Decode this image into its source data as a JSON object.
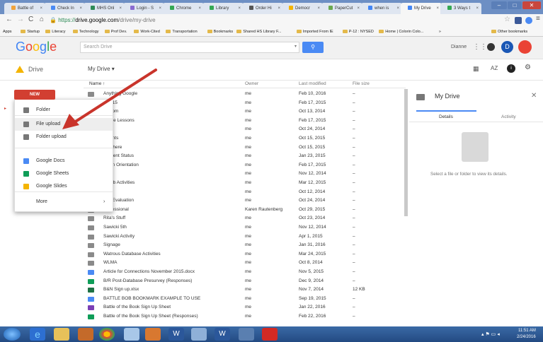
{
  "browser": {
    "tabs": [
      {
        "label": "Battle of",
        "color": "#f1a33b"
      },
      {
        "label": "Check In",
        "color": "#4a8af4"
      },
      {
        "label": "MHS Onl",
        "color": "#2e8b57"
      },
      {
        "label": "Login - S",
        "color": "#8a6bd1"
      },
      {
        "label": "Chrome",
        "color": "#34a853"
      },
      {
        "label": "Library",
        "color": "#34a853"
      },
      {
        "label": "Order Hi",
        "color": "#555555"
      },
      {
        "label": "Democr",
        "color": "#f4b400"
      },
      {
        "label": "PaperCut",
        "color": "#6aa84f"
      },
      {
        "label": "when is",
        "color": "#4285f4"
      },
      {
        "label": "My Drive",
        "color": "#4285f4"
      },
      {
        "label": "3 Ways t",
        "color": "#34a853"
      }
    ],
    "url_prefix": "https://",
    "url_host": "drive.google.com",
    "url_path": "/drive/my-drive",
    "bookmarks": [
      {
        "label": "Apps"
      },
      {
        "label": "Startup"
      },
      {
        "label": "Literacy"
      },
      {
        "label": "Technology"
      },
      {
        "label": "Prof Dev."
      },
      {
        "label": "Work-Cited"
      },
      {
        "label": "Transportation"
      },
      {
        "label": "Bookmarks"
      },
      {
        "label": "Shared HS Library F..."
      },
      {
        "label": "Imported From IE"
      },
      {
        "label": "P-12 : NYSED"
      },
      {
        "label": "Home | Colorin Colo..."
      },
      {
        "label": "»"
      },
      {
        "label": "Other bookmarks"
      }
    ]
  },
  "google": {
    "logo": "Google",
    "search_placeholder": "Search Drive",
    "user_name": "Dianne",
    "avatar_letter": "D"
  },
  "drive": {
    "title": "Drive",
    "breadcrumb": "My Drive",
    "new_label": "NEW",
    "menu": [
      {
        "label": "Folder",
        "icon": "folder-plus-icon",
        "color": "#777777"
      },
      {
        "label": "File upload",
        "icon": "file-upload-icon",
        "color": "#777777"
      },
      {
        "label": "Folder upload",
        "icon": "folder-upload-icon",
        "color": "#777777"
      },
      {
        "label": "Google Docs",
        "icon": "docs-icon",
        "color": "#4a8af4"
      },
      {
        "label": "Google Sheets",
        "icon": "sheets-icon",
        "color": "#0f9d58"
      },
      {
        "label": "Google Slides",
        "icon": "slides-icon",
        "color": "#f4b400"
      },
      {
        "label": "More",
        "icon": "",
        "color": ""
      }
    ],
    "columns": {
      "name": "Name",
      "owner": "Owner",
      "modified": "Last modified",
      "size": "File size"
    },
    "files": [
      {
        "name": "Anything Google",
        "owner": "me",
        "modified": "Feb 10, 2016",
        "size": "–",
        "type": "folder"
      },
      {
        "name": "e 2015",
        "owner": "me",
        "modified": "Feb 17, 2015",
        "size": "–",
        "type": "folder"
      },
      {
        "name": "ssroom",
        "owner": "me",
        "modified": "Oct 13, 2014",
        "size": "–",
        "type": "folder"
      },
      {
        "name": "abase Lessons",
        "owner": "me",
        "modified": "Feb 17, 2015",
        "size": "–",
        "type": "folder"
      },
      {
        "name": "ktop",
        "owner": "me",
        "modified": "Oct 24, 2014",
        "size": "–",
        "type": "folder"
      },
      {
        "name": "uments",
        "owner": "me",
        "modified": "Oct 15, 2015",
        "size": "–",
        "type": "folder"
      },
      {
        "name": "files here",
        "owner": "me",
        "modified": "Oct 15, 2015",
        "size": "–",
        "type": "folder"
      },
      {
        "name": "loyment Status",
        "owner": "me",
        "modified": "Jan 23, 2015",
        "size": "–",
        "type": "folder"
      },
      {
        "name": "hman Orientation",
        "owner": "me",
        "modified": "Feb 17, 2015",
        "size": "–",
        "type": "folder"
      },
      {
        "name": "Club",
        "owner": "me",
        "modified": "Nov 12, 2014",
        "size": "–",
        "type": "folder"
      },
      {
        "name": "r Web Activities",
        "owner": "me",
        "modified": "Mar 12, 2015",
        "size": "–",
        "type": "folder"
      },
      {
        "name": "P     ★",
        "owner": "me",
        "modified": "Oct 12, 2014",
        "size": "–",
        "type": "folder"
      },
      {
        "name": "and Evaluation",
        "owner": "me",
        "modified": "Oct 24, 2014",
        "size": "–",
        "type": "folder"
      },
      {
        "name": "Professional",
        "owner": "Karen Rautenberg",
        "modified": "Oct 29, 2015",
        "size": "–",
        "type": "folder"
      },
      {
        "name": "Rita's Stuff",
        "owner": "me",
        "modified": "Oct 23, 2014",
        "size": "–",
        "type": "folder"
      },
      {
        "name": "Sawicki 5th",
        "owner": "me",
        "modified": "Nov 12, 2014",
        "size": "–",
        "type": "folder"
      },
      {
        "name": "Sawicki Activity",
        "owner": "me",
        "modified": "Apr 1, 2015",
        "size": "–",
        "type": "folder"
      },
      {
        "name": "Signage",
        "owner": "me",
        "modified": "Jan 31, 2016",
        "size": "–",
        "type": "folder"
      },
      {
        "name": "Watrous Database Activities",
        "owner": "me",
        "modified": "Mar 24, 2015",
        "size": "–",
        "type": "folder"
      },
      {
        "name": "WLMA",
        "owner": "me",
        "modified": "Oct 8, 2014",
        "size": "–",
        "type": "folder"
      },
      {
        "name": "Article for Connections November 2015.docx",
        "owner": "me",
        "modified": "Nov 5, 2015",
        "size": "–",
        "type": "doc"
      },
      {
        "name": "B/R Post-Database Presurvey (Responses)",
        "owner": "me",
        "modified": "Dec 9, 2014",
        "size": "–",
        "type": "sheet"
      },
      {
        "name": "B&N Sign up.xlsx",
        "owner": "me",
        "modified": "Nov 7, 2014",
        "size": "12 KB",
        "type": "excel"
      },
      {
        "name": "BATTLE BOB BOOKMARK EXAMPLE TO USE",
        "owner": "me",
        "modified": "Sep 19, 2015",
        "size": "–",
        "type": "doc"
      },
      {
        "name": "Battle of the Book Sign Up Sheet",
        "owner": "me",
        "modified": "Jan 22, 2016",
        "size": "–",
        "type": "form"
      },
      {
        "name": "Battle of the Book Sign Up Sheet (Responses)",
        "owner": "me",
        "modified": "Feb 22, 2016",
        "size": "–",
        "type": "sheet"
      }
    ],
    "details": {
      "title": "My Drive",
      "tab_details": "Details",
      "tab_activity": "Activity",
      "empty_message": "Select a file or folder to view its details."
    }
  },
  "taskbar": {
    "time": "11:51 AM",
    "date": "2/24/2016"
  }
}
